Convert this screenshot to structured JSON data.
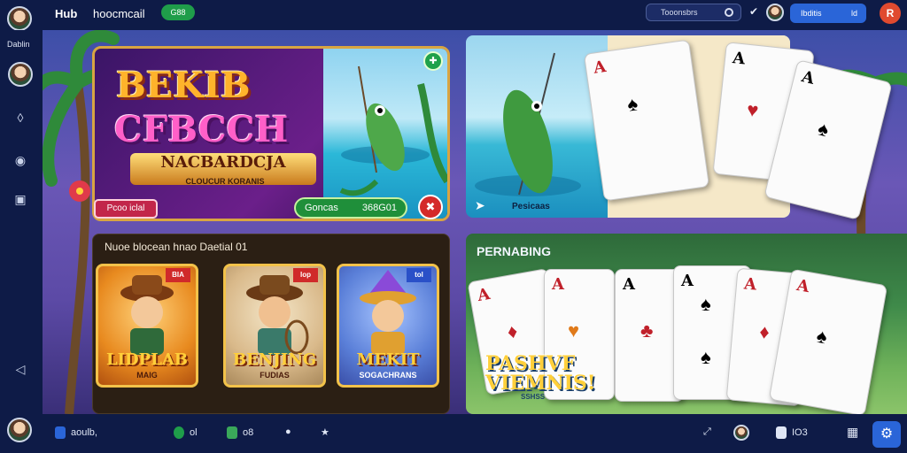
{
  "topbar": {
    "title": "Hub",
    "app_name": "hoocmcail",
    "pill": "G88",
    "search_placeholder": "Tooonsbrs",
    "blue_pill_label": "Ibditis",
    "blue_pill_num": "ld",
    "close_glyph": "R"
  },
  "sidebar": {
    "label": "Dablin"
  },
  "bottombar": {
    "user": "aoulb,",
    "items": [
      "ol",
      "o8"
    ],
    "count": "IO3"
  },
  "banner1": {
    "title_line1": "BEKIB",
    "title_line2": "CFBCCH",
    "subtitle": "NACBARDCJA",
    "tagline": "CLOUCUR KORANIS",
    "pink_button": "Pcoo iclal",
    "green_button": "Goncas",
    "green_amount": "368G01"
  },
  "banner2": {
    "label": "Pesicaas"
  },
  "games_panel": {
    "title": "Nuoe blocean hnao Daetial 01",
    "tiles": [
      {
        "name": "LIDPLAB",
        "sub": "MAIG",
        "tag": "BIA",
        "bg": "#e88a1f"
      },
      {
        "name": "BENJING",
        "sub": "FUDIAS",
        "tag": "Iop",
        "bg": "#d9b98a"
      },
      {
        "name": "MEKIT",
        "sub": "SOGACHRANS",
        "tag": "tol",
        "bg": "#5a7fd8"
      }
    ]
  },
  "cards_panel": {
    "title": "PERNABING",
    "logo_line1": "PASHVF",
    "logo_line2": "VIEMNIS!",
    "logo_sub": "SSHSS"
  },
  "colors": {
    "navy": "#0e1b47",
    "accent_blue": "#2a65d8",
    "green": "#1f8f3a",
    "red": "#d42a2a",
    "gold": "#f2c24a"
  }
}
